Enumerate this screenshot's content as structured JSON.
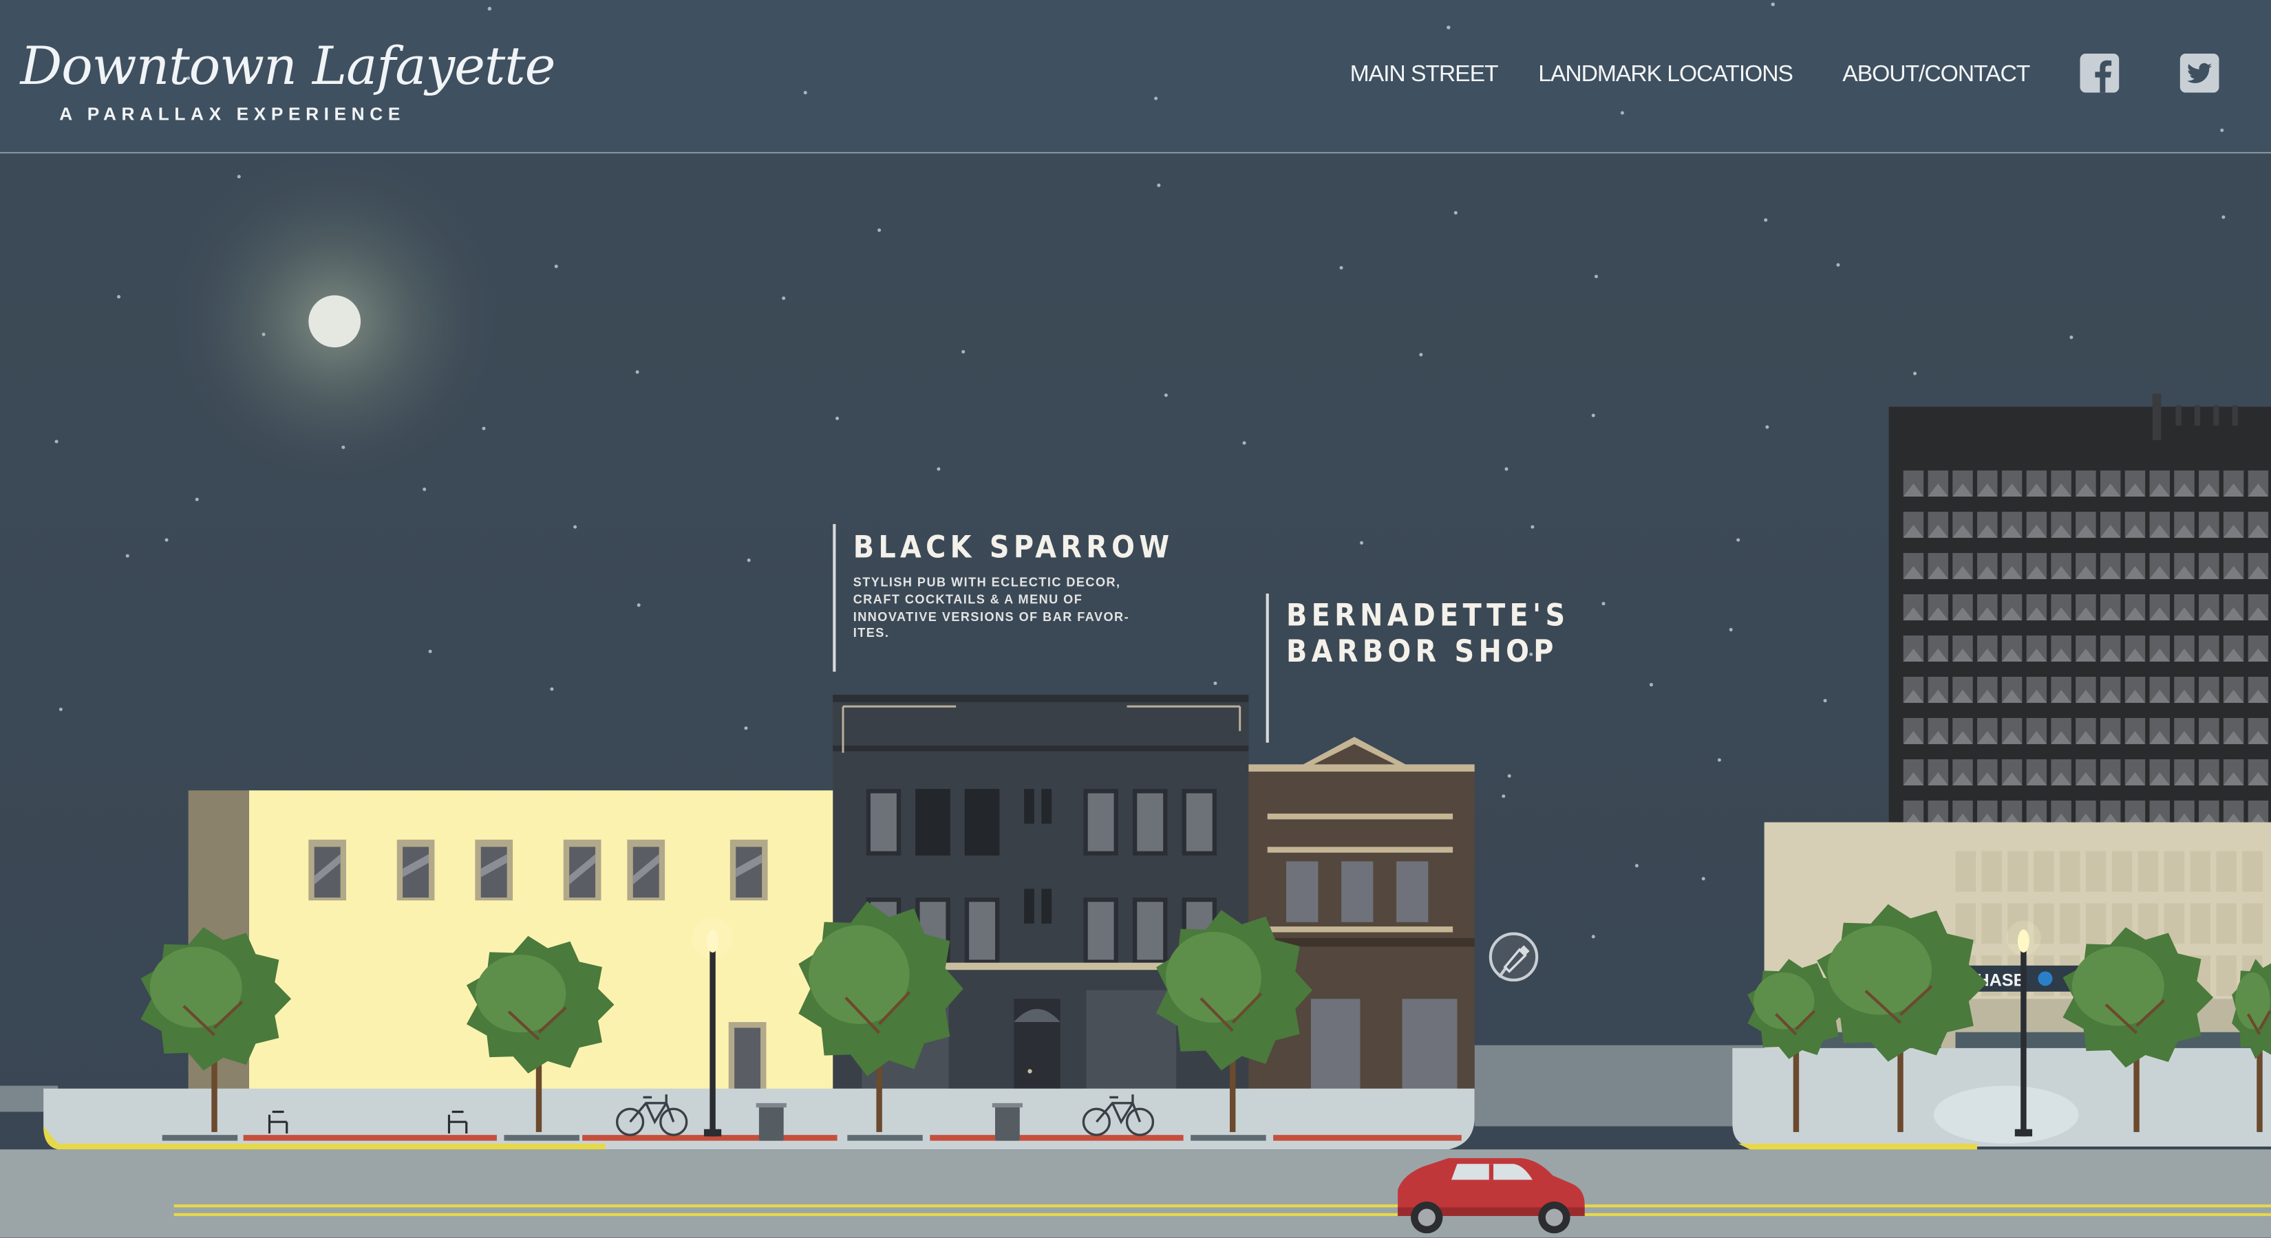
{
  "site": {
    "title": "Downtown Lafayette",
    "subtitle": "A PARALLAX EXPERIENCE"
  },
  "nav": {
    "items": [
      {
        "label": "MAIN STREET"
      },
      {
        "label": "LANDMARK LOCATIONS"
      },
      {
        "label": "ABOUT/CONTACT"
      }
    ],
    "social": [
      {
        "icon": "facebook-icon"
      },
      {
        "icon": "twitter-icon"
      }
    ]
  },
  "landmarks": [
    {
      "title": "BLACK SPARROW",
      "description": "STYLISH PUB WITH ECLECTIC DECOR, CRAFT COCKTAILS & A MENU OF INNOVATIVE VERSIONS OF BAR FAVOR-ITES."
    },
    {
      "title_line1": "BERNADETTE'S",
      "title_line2": "BARBOR SHOP"
    }
  ],
  "bank_sign": "CHASE",
  "info_button_icon": "brush-icon",
  "colors": {
    "sky": "#3f4e5c",
    "road": "#9ba5a8",
    "sidewalk": "#c9d3d6",
    "yellow_building": "#fcf2b0",
    "dark_building": "#3a4048",
    "barber_shop": "#54473d",
    "office_tower": "#2a2b2d",
    "bank": "#d6cfb5",
    "tree": "#4a7a3c",
    "car": "#c0373a"
  }
}
